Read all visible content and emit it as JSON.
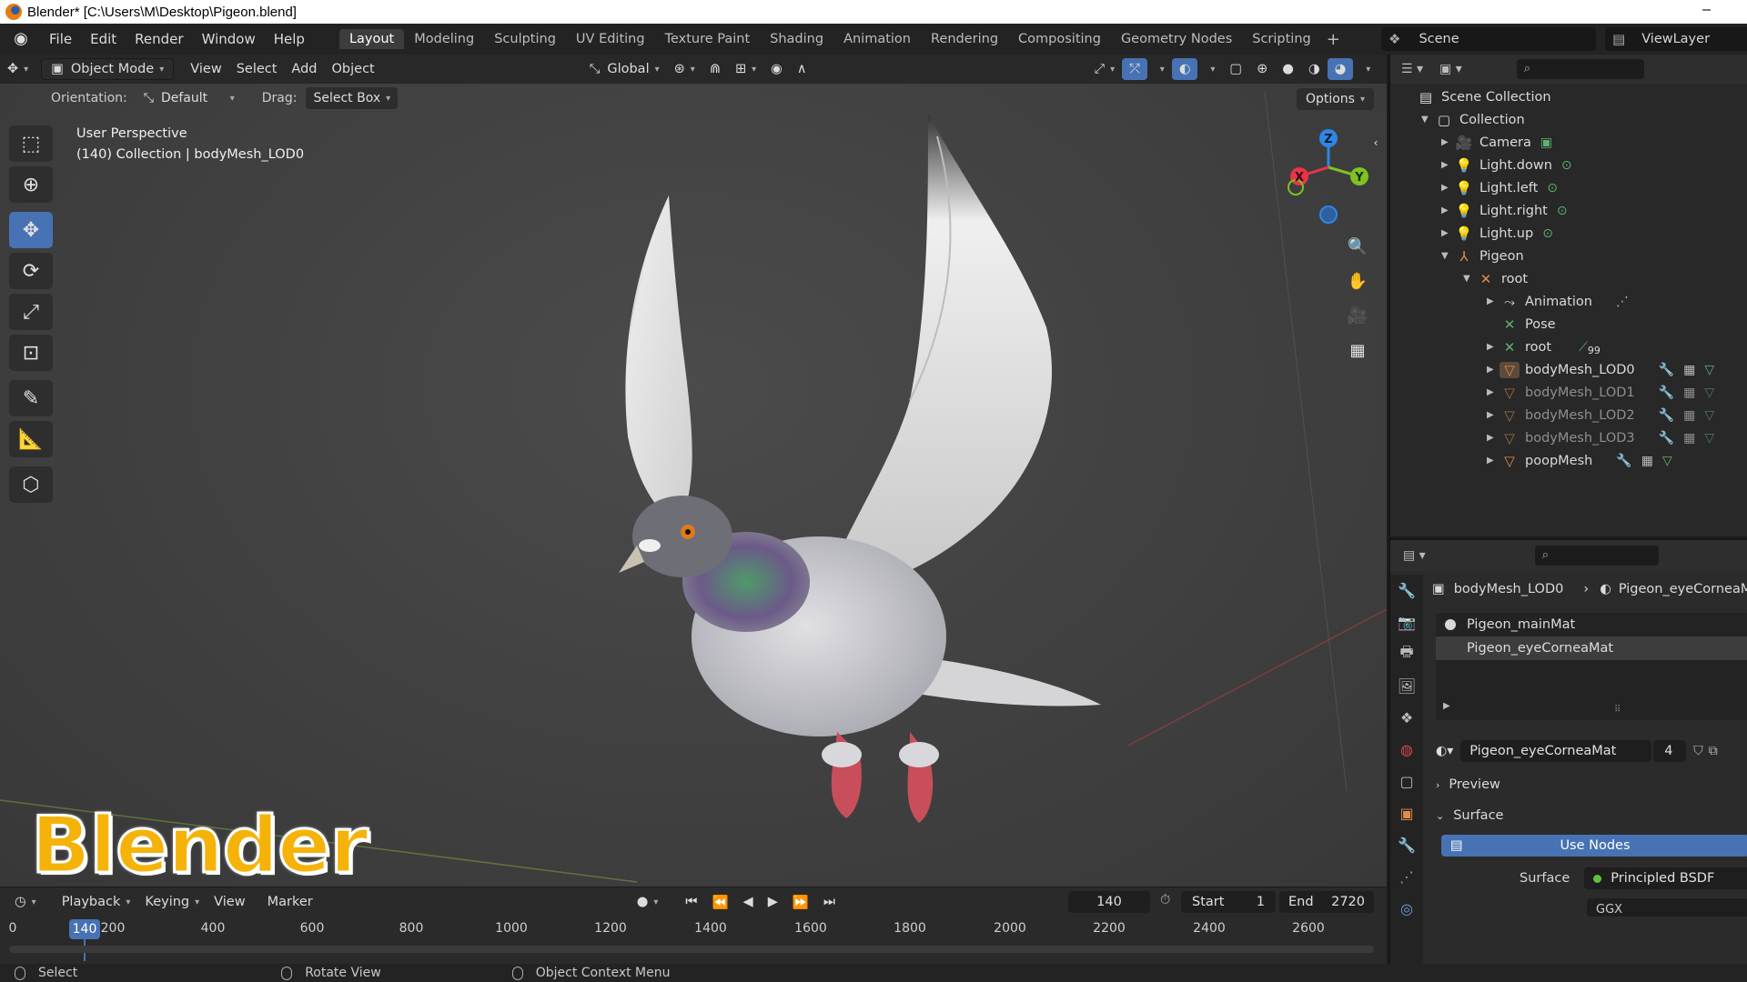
{
  "window": {
    "title": "Blender* [C:\\Users\\M\\Desktop\\Pigeon.blend]",
    "minimize": "–"
  },
  "menu": [
    "File",
    "Edit",
    "Render",
    "Window",
    "Help"
  ],
  "workspaces": [
    "Layout",
    "Modeling",
    "Sculpting",
    "UV Editing",
    "Texture Paint",
    "Shading",
    "Animation",
    "Rendering",
    "Compositing",
    "Geometry Nodes",
    "Scripting"
  ],
  "workspace_add": "+",
  "scene": {
    "label": "Scene",
    "viewlayer": "ViewLayer"
  },
  "viewport": {
    "mode": "Object Mode",
    "menus": [
      "View",
      "Select",
      "Add",
      "Object"
    ],
    "transform": "Global",
    "orientation_label": "Orientation:",
    "orientation_value": "Default",
    "drag_label": "Drag:",
    "drag_value": "Select Box",
    "options": "Options",
    "perspective": "User Perspective",
    "context": "(140) Collection | bodyMesh_LOD0",
    "gizmo": {
      "x": "X",
      "y": "Y",
      "z": "Z"
    },
    "watermark": "Blender"
  },
  "timeline": {
    "menus": [
      "Playback",
      "Keying",
      "View",
      "Marker"
    ],
    "current_frame": "140",
    "start_label": "Start",
    "start": "1",
    "end_label": "End",
    "end": "2720",
    "ticks": [
      "0",
      "200",
      "400",
      "600",
      "800",
      "1000",
      "1200",
      "1400",
      "1600",
      "1800",
      "2000",
      "2200",
      "2400",
      "2600"
    ]
  },
  "status": [
    "Select",
    "Rotate View",
    "Object Context Menu"
  ],
  "outliner": {
    "scene_collection": "Scene Collection",
    "collection": "Collection",
    "items": {
      "camera": "Camera",
      "light_down": "Light.down",
      "light_left": "Light.left",
      "light_right": "Light.right",
      "light_up": "Light.up",
      "pigeon": "Pigeon",
      "root": "root",
      "animation": "Animation",
      "pose": "Pose",
      "root_bones": "root",
      "bone_count": "99",
      "lod0": "bodyMesh_LOD0",
      "lod1": "bodyMesh_LOD1",
      "lod2": "bodyMesh_LOD2",
      "lod3": "bodyMesh_LOD3",
      "poop": "poopMesh"
    }
  },
  "properties": {
    "object": "bodyMesh_LOD0",
    "material": "Pigeon_eyeCorneaMat",
    "slots": [
      "Pigeon_mainMat",
      "Pigeon_eyeCorneaMat"
    ],
    "material_field": "Pigeon_eyeCorneaMat",
    "users": "4",
    "preview": "Preview",
    "surface_panel": "Surface",
    "use_nodes": "Use Nodes",
    "surface_label": "Surface",
    "surface_value": "Principled BSDF",
    "distribution": "GGX"
  },
  "colors": {
    "accent": "#4772b3",
    "x_axis": "#e8344a",
    "y_axis": "#7ec321",
    "z_axis": "#2e87e6",
    "watermark": "#f5b30a"
  }
}
